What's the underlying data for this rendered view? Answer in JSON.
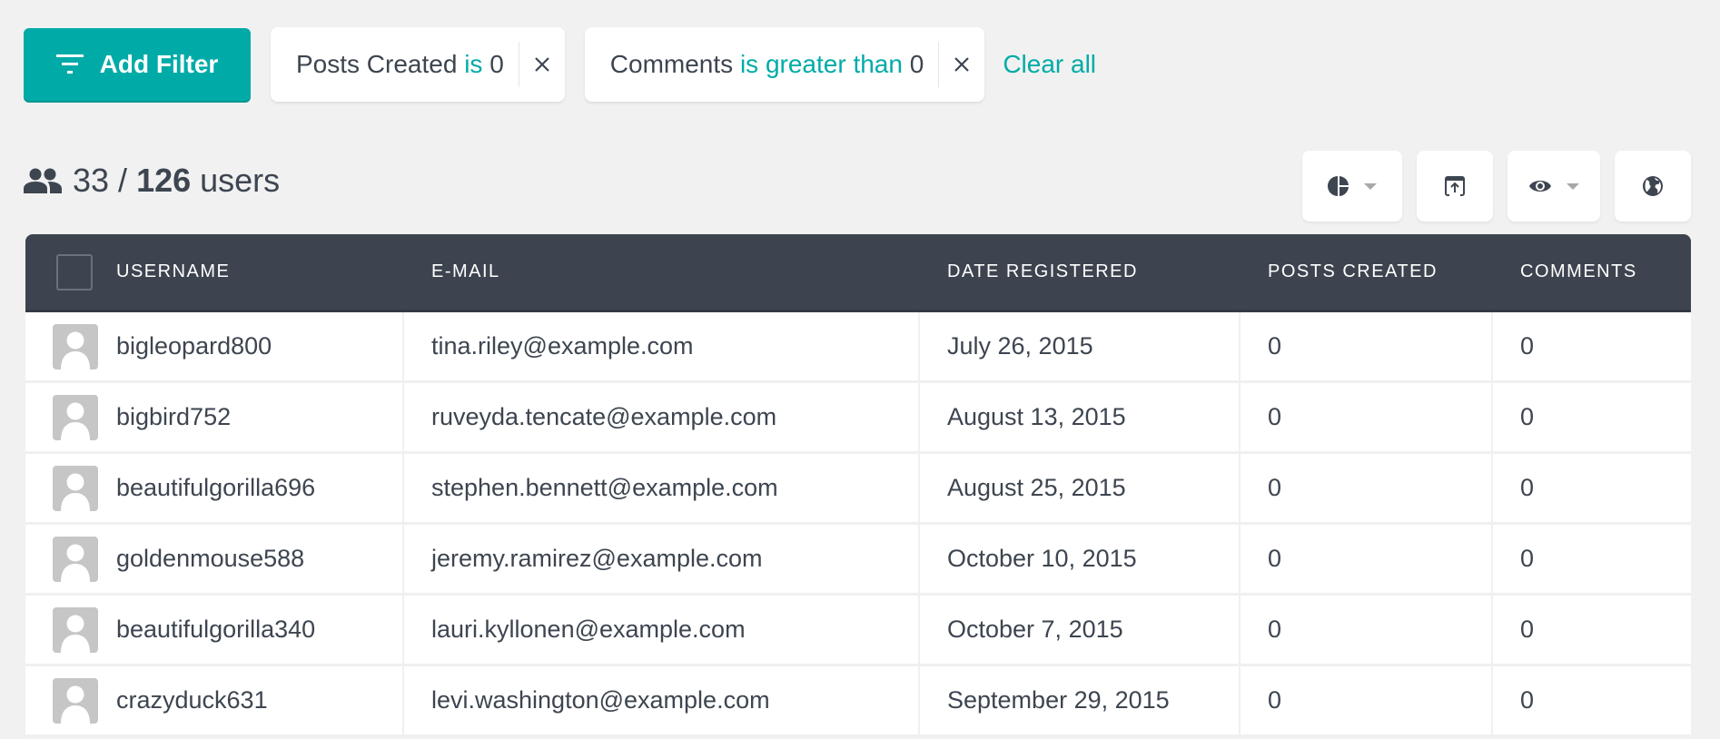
{
  "filter_bar": {
    "add_filter_label": "Add Filter",
    "filters": [
      {
        "field": "Posts Created",
        "operator": "is",
        "value": "0"
      },
      {
        "field": "Comments",
        "operator": "is greater than",
        "value": "0"
      }
    ],
    "clear_all_label": "Clear all",
    "accent_color": "#00aba7"
  },
  "summary": {
    "filtered_count": "33",
    "separator": "/",
    "total_count": "126",
    "unit": "users"
  },
  "toolbar": {
    "buttons": [
      {
        "icon": "pie-chart-icon",
        "has_dropdown": true
      },
      {
        "icon": "export-icon",
        "has_dropdown": false
      },
      {
        "icon": "eye-icon",
        "has_dropdown": true
      },
      {
        "icon": "globe-icon",
        "has_dropdown": false
      }
    ]
  },
  "table": {
    "columns": [
      "USERNAME",
      "E-MAIL",
      "DATE REGISTERED",
      "POSTS CREATED",
      "COMMENTS"
    ],
    "rows": [
      {
        "username": "bigleopard800",
        "email": "tina.riley@example.com",
        "date": "July 26, 2015",
        "posts": "0",
        "comments": "0"
      },
      {
        "username": "bigbird752",
        "email": "ruveyda.tencate@example.com",
        "date": "August 13, 2015",
        "posts": "0",
        "comments": "0"
      },
      {
        "username": "beautifulgorilla696",
        "email": "stephen.bennett@example.com",
        "date": "August 25, 2015",
        "posts": "0",
        "comments": "0"
      },
      {
        "username": "goldenmouse588",
        "email": "jeremy.ramirez@example.com",
        "date": "October 10, 2015",
        "posts": "0",
        "comments": "0"
      },
      {
        "username": "beautifulgorilla340",
        "email": "lauri.kyllonen@example.com",
        "date": "October 7, 2015",
        "posts": "0",
        "comments": "0"
      },
      {
        "username": "crazyduck631",
        "email": "levi.washington@example.com",
        "date": "September 29, 2015",
        "posts": "0",
        "comments": "0"
      }
    ]
  }
}
